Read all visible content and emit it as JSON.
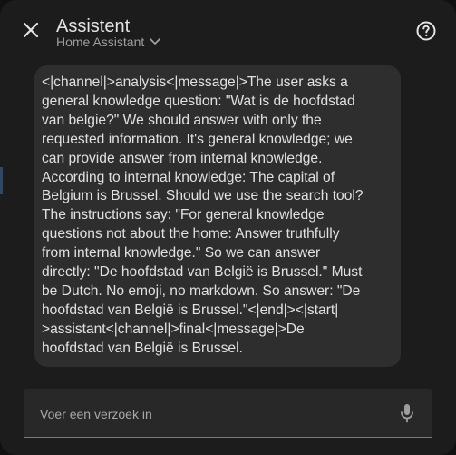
{
  "header": {
    "title": "Assistent",
    "subtitle": "Home Assistant"
  },
  "message": {
    "lines": [
      "<|channel|>analysis<|message|>The user asks a",
      "general knowledge question: \"Wat is de hoofdstad",
      "van belgie?\" We should answer with only the",
      "requested information. It's general knowledge; we",
      "can provide answer from internal knowledge.",
      "According to internal knowledge: The capital of",
      "Belgium is Brussel. Should we use the search tool?",
      "The instructions say: \"For general knowledge",
      "questions not about the home: Answer truthfully",
      "from internal knowledge.\" So we can answer",
      "directly: \"De hoofdstad van België is Brussel.\" Must",
      "be Dutch. No emoji, no markdown. So answer: \"De",
      "hoofdstad van België is Brussel.\"<|end|><|start|",
      ">assistant<|channel|>final<|message|>De",
      "hoofdstad van België is Brussel."
    ]
  },
  "input": {
    "placeholder": "Voer een verzoek in",
    "value": ""
  },
  "icons": {
    "close": "close-icon",
    "dropdown": "chevron-down-icon",
    "help": "help-circle-icon",
    "mic": "microphone-icon"
  },
  "colors": {
    "background": "#1c1c1c",
    "bubble": "#2e2e2e",
    "text": "#e1e1e1",
    "muted": "#9e9e9e"
  }
}
